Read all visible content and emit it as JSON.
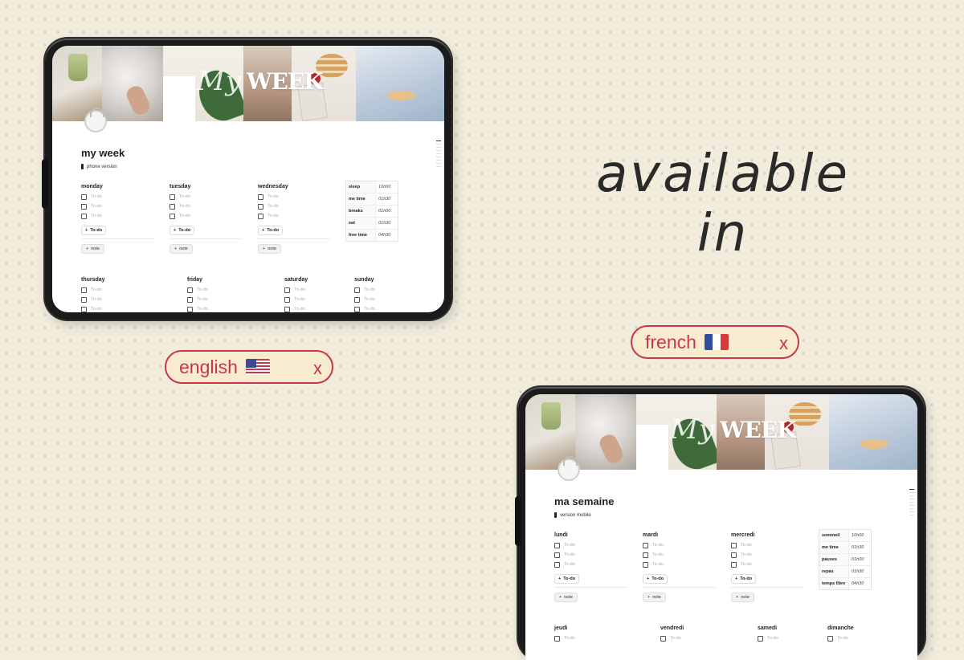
{
  "headline": "available in",
  "english_pill": {
    "label": "english",
    "flag": "us-flag-icon",
    "close": "x"
  },
  "french_pill": {
    "label": "french",
    "flag": "fr-flag-icon",
    "close": "x"
  },
  "colors": {
    "accent": "#c8364a",
    "background": "#f1ecdc",
    "pill_fill": "#f8ecd0"
  },
  "cover_title": {
    "my": "My",
    "week": "WEEK"
  },
  "english": {
    "title": "my week",
    "subtitle": "phone version",
    "days_top": [
      {
        "name": "monday",
        "todos": [
          "To-do",
          "To-do",
          "To-do"
        ]
      },
      {
        "name": "tuesday",
        "todos": [
          "To-do",
          "To-do",
          "To-do"
        ]
      },
      {
        "name": "wednesday",
        "todos": [
          "To-do",
          "To-do",
          "To-do"
        ]
      }
    ],
    "days_bottom": [
      {
        "name": "thursday",
        "todos": [
          "To-do",
          "To-do",
          "To-do"
        ]
      },
      {
        "name": "friday",
        "todos": [
          "To-do",
          "To-do",
          "To-do"
        ]
      },
      {
        "name": "saturday",
        "todos": [
          "To-do",
          "To-do",
          "To-do"
        ]
      },
      {
        "name": "sunday",
        "todos": [
          "To-do",
          "To-do",
          "To-do"
        ]
      }
    ],
    "add_todo": "To-do",
    "note": "note",
    "stats": [
      {
        "label": "sleep",
        "value": "10h00"
      },
      {
        "label": "me time",
        "value": "01h30"
      },
      {
        "label": "breaks",
        "value": "01h00"
      },
      {
        "label": "eat",
        "value": "01h30"
      },
      {
        "label": "free time",
        "value": "04h30"
      }
    ]
  },
  "french": {
    "title": "ma semaine",
    "subtitle": "version mobile",
    "days_top": [
      {
        "name": "lundi",
        "todos": [
          "To-do",
          "To-do",
          "To-do"
        ]
      },
      {
        "name": "mardi",
        "todos": [
          "To-do",
          "To-do",
          "To-do"
        ]
      },
      {
        "name": "mercredi",
        "todos": [
          "To-do",
          "To-do",
          "To-do"
        ]
      }
    ],
    "days_bottom": [
      {
        "name": "jeudi",
        "todos": [
          "To-do"
        ]
      },
      {
        "name": "vendredi",
        "todos": [
          "To-do"
        ]
      },
      {
        "name": "samedi",
        "todos": [
          "To-do"
        ]
      },
      {
        "name": "dimanche",
        "todos": [
          "To-do"
        ]
      }
    ],
    "add_todo": "To-do",
    "note": "note",
    "stats": [
      {
        "label": "sommeil",
        "value": "10h00"
      },
      {
        "label": "me time",
        "value": "01h30"
      },
      {
        "label": "pauses",
        "value": "01h00"
      },
      {
        "label": "repas",
        "value": "01h30"
      },
      {
        "label": "temps libre",
        "value": "04h30"
      }
    ]
  }
}
